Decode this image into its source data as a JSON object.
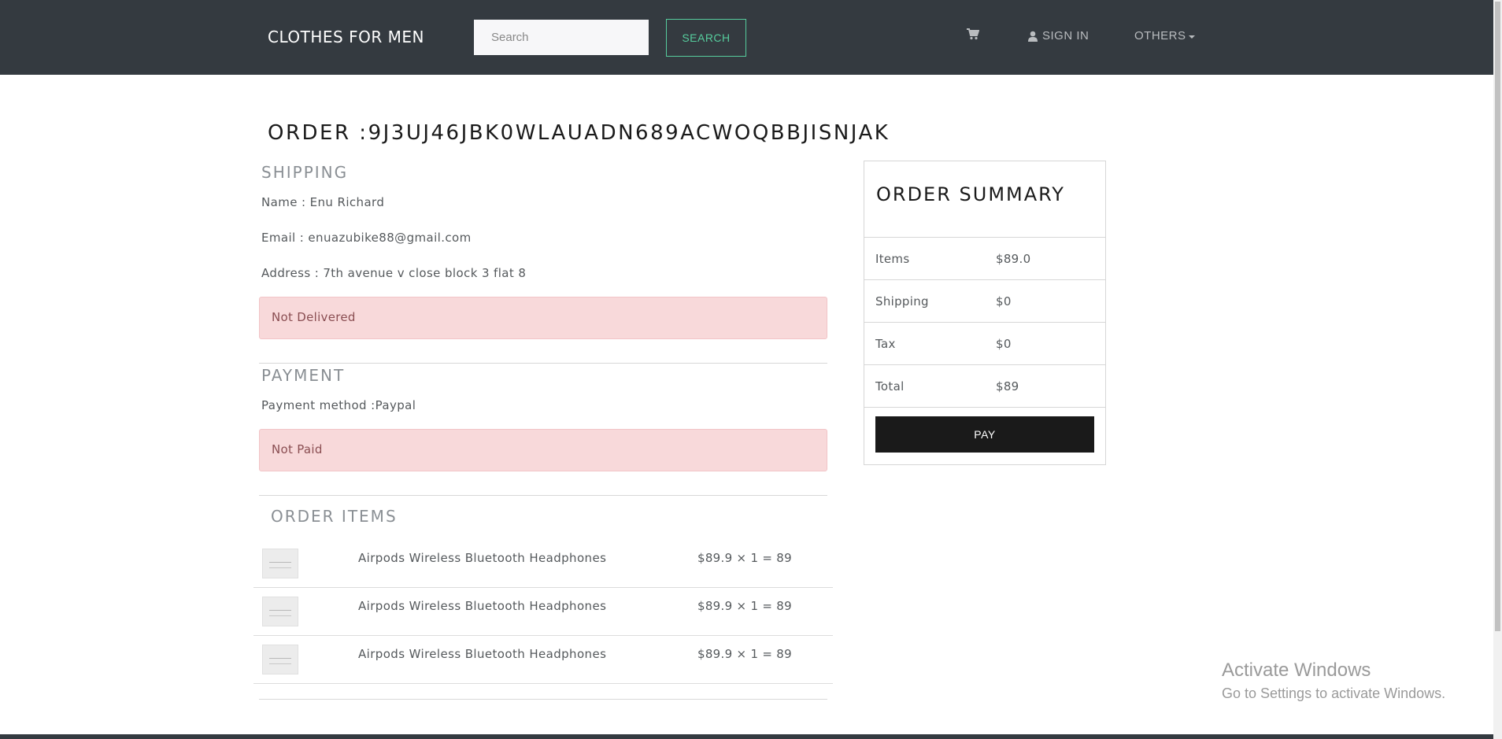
{
  "nav": {
    "brand": "CLOTHES FOR MEN",
    "search_placeholder": "Search",
    "search_button": "SEARCH",
    "cart_icon": "cart-icon",
    "sign_in": "SIGN IN",
    "others": "OTHERS"
  },
  "order": {
    "title": "ORDER :9J3UJ46JBK0WLAUADN689ACWOQBBJISNJAK"
  },
  "shipping": {
    "heading": "SHIPPING",
    "name": "Name : Enu Richard",
    "email": "Email : enuazubike88@gmail.com",
    "address": "Address : 7th avenue v close block 3 flat 8",
    "status": "Not Delivered"
  },
  "payment": {
    "heading": "PAYMENT",
    "method": "Payment method :Paypal",
    "status": "Not Paid"
  },
  "order_items": {
    "heading": "ORDER ITEMS",
    "items": [
      {
        "name": "Airpods Wireless Bluetooth Headphones",
        "price": "$89.9 × 1 = 89"
      },
      {
        "name": "Airpods Wireless Bluetooth Headphones",
        "price": "$89.9 × 1 = 89"
      },
      {
        "name": "Airpods Wireless Bluetooth Headphones",
        "price": "$89.9 × 1 = 89"
      }
    ]
  },
  "summary": {
    "title": "ORDER SUMMARY",
    "rows": [
      {
        "label": "Items",
        "value": "$89.0"
      },
      {
        "label": "Shipping",
        "value": "$0"
      },
      {
        "label": "Tax",
        "value": "$0"
      },
      {
        "label": "Total",
        "value": "$89"
      }
    ],
    "pay_button": "PAY"
  },
  "watermark": {
    "title": "Activate Windows",
    "subtitle": "Go to Settings to activate Windows."
  },
  "colors": {
    "navbar": "#343a40",
    "accent": "#56cc9d",
    "alert_bg": "#f8d9da",
    "pay_button": "#1a1a1a"
  }
}
